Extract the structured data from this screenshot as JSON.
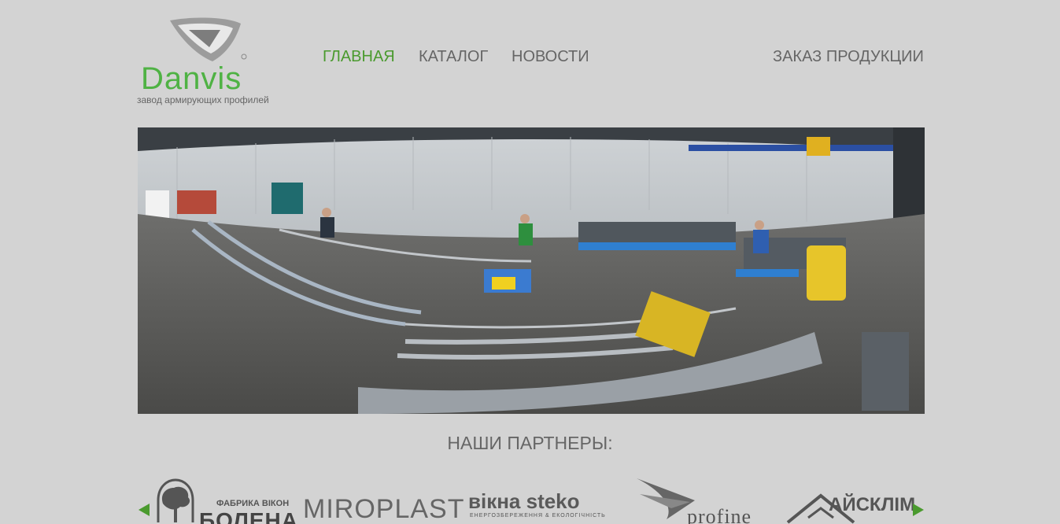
{
  "logo": {
    "brand": "Danvis",
    "tagline": "завод армирующих профилей"
  },
  "nav": {
    "home": "ГЛАВНАЯ",
    "catalog": "КАТАЛОГ",
    "news": "НОВОСТИ",
    "order": "ЗАКАЗ ПРОДУКЦИИ"
  },
  "partners": {
    "title": "НАШИ ПАРТНЕРЫ:",
    "items": [
      {
        "line1": "ФАБРИКА ВІКОН",
        "line2": "БОЛЕНА"
      },
      {
        "name": "MIROPLAST"
      },
      {
        "name": "вікна steko",
        "sub": "ЕНЕРГОЗБЕРЕЖЕННЯ & ЕКОЛОГІЧНІСТЬ"
      },
      {
        "name": "profine"
      },
      {
        "name": "АЙСКЛІМ"
      }
    ]
  },
  "colors": {
    "accent": "#4a9a2e",
    "brand": "#4fb244",
    "background": "#d3d3d3",
    "nav_text": "#666666"
  }
}
